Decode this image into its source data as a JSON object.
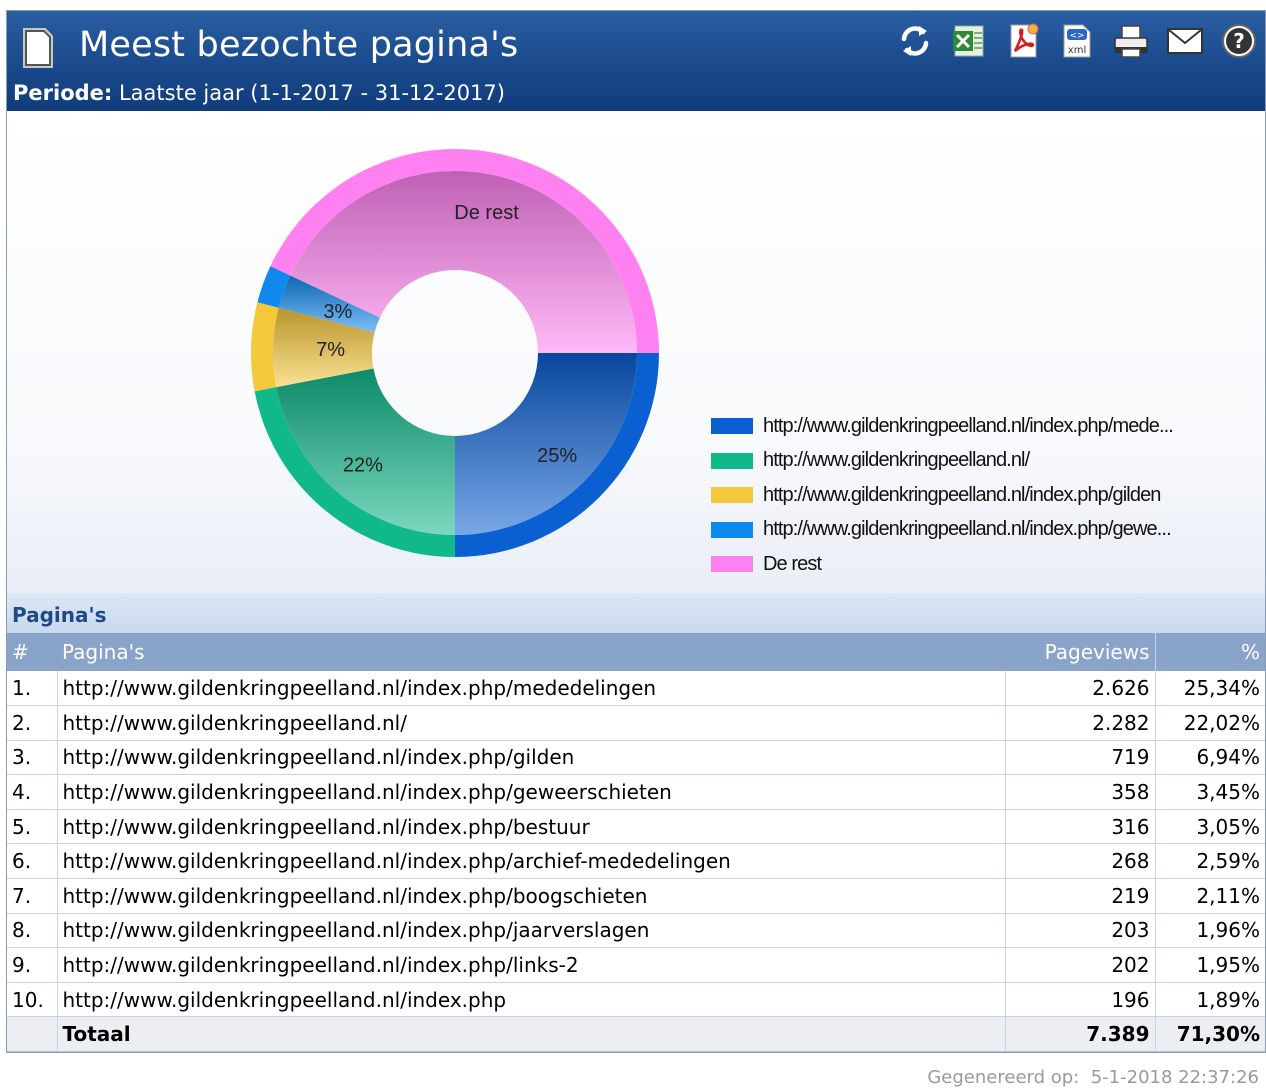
{
  "header": {
    "title": "Meest bezochte pagina's",
    "period_label": "Periode:",
    "period_value": "Laatste jaar (1-1-2017 - 31-12-2017)",
    "toolbar": [
      {
        "name": "refresh-icon"
      },
      {
        "name": "excel-export-icon"
      },
      {
        "name": "pdf-export-icon"
      },
      {
        "name": "xml-export-icon"
      },
      {
        "name": "print-icon"
      },
      {
        "name": "email-icon"
      },
      {
        "name": "help-icon"
      }
    ]
  },
  "colors": {
    "header": "#1a4a8c",
    "series": [
      "#0a5fd1",
      "#10b88a",
      "#f5c83a",
      "#1188ee",
      "#ff80f0"
    ]
  },
  "chart_data": {
    "type": "pie",
    "style": "donut",
    "legend_position": "right",
    "slices": [
      {
        "label": "http://www.gildenkringpeelland.nl/index.php/mede...",
        "value": 25,
        "data_label": "25%"
      },
      {
        "label": "http://www.gildenkringpeelland.nl/",
        "value": 22,
        "data_label": "22%"
      },
      {
        "label": "http://www.gildenkringpeelland.nl/index.php/gilden",
        "value": 7,
        "data_label": "7%"
      },
      {
        "label": "http://www.gildenkringpeelland.nl/index.php/gewe...",
        "value": 3,
        "data_label": "3%"
      },
      {
        "label": "De rest",
        "value": 43,
        "data_label": "De rest"
      }
    ]
  },
  "table": {
    "section_title": "Pagina's",
    "columns": [
      "#",
      "Pagina's",
      "Pageviews",
      "%"
    ],
    "rows": [
      {
        "rank": "1.",
        "url": "http://www.gildenkringpeelland.nl/index.php/mededelingen",
        "pageviews": "2.626",
        "pct": "25,34%"
      },
      {
        "rank": "2.",
        "url": "http://www.gildenkringpeelland.nl/",
        "pageviews": "2.282",
        "pct": "22,02%"
      },
      {
        "rank": "3.",
        "url": "http://www.gildenkringpeelland.nl/index.php/gilden",
        "pageviews": "719",
        "pct": "6,94%"
      },
      {
        "rank": "4.",
        "url": "http://www.gildenkringpeelland.nl/index.php/geweerschieten",
        "pageviews": "358",
        "pct": "3,45%"
      },
      {
        "rank": "5.",
        "url": "http://www.gildenkringpeelland.nl/index.php/bestuur",
        "pageviews": "316",
        "pct": "3,05%"
      },
      {
        "rank": "6.",
        "url": "http://www.gildenkringpeelland.nl/index.php/archief-mededelingen",
        "pageviews": "268",
        "pct": "2,59%"
      },
      {
        "rank": "7.",
        "url": "http://www.gildenkringpeelland.nl/index.php/boogschieten",
        "pageviews": "219",
        "pct": "2,11%"
      },
      {
        "rank": "8.",
        "url": "http://www.gildenkringpeelland.nl/index.php/jaarverslagen",
        "pageviews": "203",
        "pct": "1,96%"
      },
      {
        "rank": "9.",
        "url": "http://www.gildenkringpeelland.nl/index.php/links-2",
        "pageviews": "202",
        "pct": "1,95%"
      },
      {
        "rank": "10.",
        "url": "http://www.gildenkringpeelland.nl/index.php",
        "pageviews": "196",
        "pct": "1,89%"
      }
    ],
    "total": {
      "label": "Totaal",
      "pageviews": "7.389",
      "pct": "71,30%"
    }
  },
  "footer": {
    "generated_label": "Gegenereerd op:",
    "generated_value": "5-1-2018 22:37:26"
  }
}
